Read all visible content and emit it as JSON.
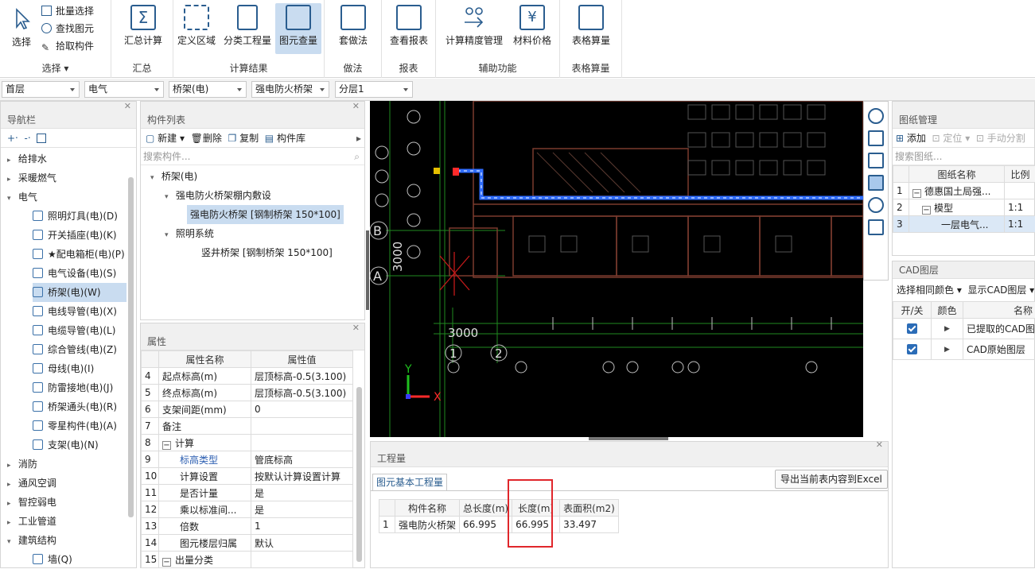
{
  "ribbon": {
    "select": {
      "label": "选择",
      "batch_select": "批量选择",
      "find_element": "查找图元",
      "pick_component": "拾取构件",
      "group": "选择"
    },
    "summary": {
      "label": "汇总计算",
      "group": "汇总"
    },
    "results": {
      "define_area": "定义区域",
      "classify_qty": "分类工程量",
      "element_qty": "图元查量",
      "group": "计算结果"
    },
    "method": {
      "label": "套做法",
      "group": "做法"
    },
    "report": {
      "label": "查看报表",
      "group": "报表"
    },
    "aux": {
      "precision": "计算精度管理",
      "material_price": "材料价格",
      "group": "辅助功能"
    },
    "table_calc": {
      "label": "表格算量",
      "group": "表格算量"
    }
  },
  "selectors": [
    "首层",
    "电气",
    "桥架(电)",
    "强电防火桥架",
    "分层1"
  ],
  "nav": {
    "title": "导航栏",
    "items": [
      {
        "label": "给排水",
        "expanded": false
      },
      {
        "label": "采暖燃气",
        "expanded": false
      },
      {
        "label": "电气",
        "expanded": true
      },
      {
        "label": "照明灯具(电)(D)",
        "child": true
      },
      {
        "label": "开关插座(电)(K)",
        "child": true
      },
      {
        "label": "★配电箱柜(电)(P)",
        "child": true
      },
      {
        "label": "电气设备(电)(S)",
        "child": true
      },
      {
        "label": "桥架(电)(W)",
        "child": true,
        "selected": true
      },
      {
        "label": "电线导管(电)(X)",
        "child": true
      },
      {
        "label": "电缆导管(电)(L)",
        "child": true
      },
      {
        "label": "综合管线(电)(Z)",
        "child": true
      },
      {
        "label": "母线(电)(I)",
        "child": true
      },
      {
        "label": "防雷接地(电)(J)",
        "child": true
      },
      {
        "label": "桥架通头(电)(R)",
        "child": true
      },
      {
        "label": "零星构件(电)(A)",
        "child": true
      },
      {
        "label": "支架(电)(N)",
        "child": true
      },
      {
        "label": "消防",
        "expanded": false
      },
      {
        "label": "通风空调",
        "expanded": false
      },
      {
        "label": "智控弱电",
        "expanded": false
      },
      {
        "label": "工业管道",
        "expanded": false
      },
      {
        "label": "建筑结构",
        "expanded": true
      },
      {
        "label": "墙(Q)",
        "child": true
      }
    ]
  },
  "component_list": {
    "title": "构件列表",
    "new": "新建",
    "delete": "删除",
    "copy": "复制",
    "library": "构件库",
    "search_placeholder": "搜索构件...",
    "tree": [
      {
        "label": "桥架(电)",
        "level": 0
      },
      {
        "label": "强电防火桥架棚内敷设",
        "level": 1
      },
      {
        "label": "强电防火桥架 [钢制桥架 150*100]",
        "level": 2,
        "selected": true
      },
      {
        "label": "照明系统",
        "level": 1
      },
      {
        "label": "竖井桥架 [钢制桥架 150*100]",
        "level": 2
      }
    ]
  },
  "properties": {
    "title": "属性",
    "col_name": "属性名称",
    "col_value": "属性值",
    "rows": [
      {
        "no": "4",
        "name": "起点标高(m)",
        "value": "层顶标高-0.5(3.100)"
      },
      {
        "no": "5",
        "name": "终点标高(m)",
        "value": "层顶标高-0.5(3.100)"
      },
      {
        "no": "6",
        "name": "支架间距(mm)",
        "value": "0"
      },
      {
        "no": "7",
        "name": "备注",
        "value": ""
      },
      {
        "no": "8",
        "name": "计算",
        "value": "",
        "group": true
      },
      {
        "no": "9",
        "name": "标高类型",
        "value": "管底标高",
        "link": true
      },
      {
        "no": "10",
        "name": "计算设置",
        "value": "按默认计算设置计算"
      },
      {
        "no": "11",
        "name": "是否计量",
        "value": "是"
      },
      {
        "no": "12",
        "name": "乘以标准间...",
        "value": "是"
      },
      {
        "no": "13",
        "name": "倍数",
        "value": "1"
      },
      {
        "no": "14",
        "name": "图元楼层归属",
        "value": "默认"
      },
      {
        "no": "15",
        "name": "出量分类",
        "value": "",
        "group": true
      }
    ]
  },
  "cad": {
    "labels": {
      "axis_b": "B",
      "axis_a": "A",
      "dim1": "3000",
      "dim2": "3000",
      "axis1": "1",
      "axis2": "2",
      "y": "Y",
      "x": "X"
    }
  },
  "quantities": {
    "title": "工程量",
    "tab": "图元基本工程量",
    "export": "导出当前表内容到Excel",
    "headers": [
      "构件名称",
      "总长度(m)",
      "长度(m)",
      "表面积(m2)"
    ],
    "rows": [
      {
        "no": "1",
        "name": "强电防火桥架",
        "total_length": "66.995",
        "length": "66.995",
        "area": "33.497"
      }
    ]
  },
  "drawing_mgmt": {
    "title": "图纸管理",
    "add": "添加",
    "locate": "定位",
    "manual_split": "手动分割",
    "search_placeholder": "搜索图纸...",
    "col_name": "图纸名称",
    "col_scale": "比例",
    "rows": [
      {
        "no": "1",
        "name": "德惠国土局强...",
        "scale": ""
      },
      {
        "no": "2",
        "name": "模型",
        "scale": "1:1"
      },
      {
        "no": "3",
        "name": "一层电气...",
        "scale": "1:1",
        "selected": true
      }
    ]
  },
  "cad_layers": {
    "title": "CAD图层",
    "same_color": "选择相同颜色",
    "show_layers": "显示CAD图层",
    "col_toggle": "开/关",
    "col_color": "颜色",
    "col_name": "名称",
    "rows": [
      {
        "name": "已提取的CAD图层"
      },
      {
        "name": "CAD原始图层"
      }
    ]
  }
}
